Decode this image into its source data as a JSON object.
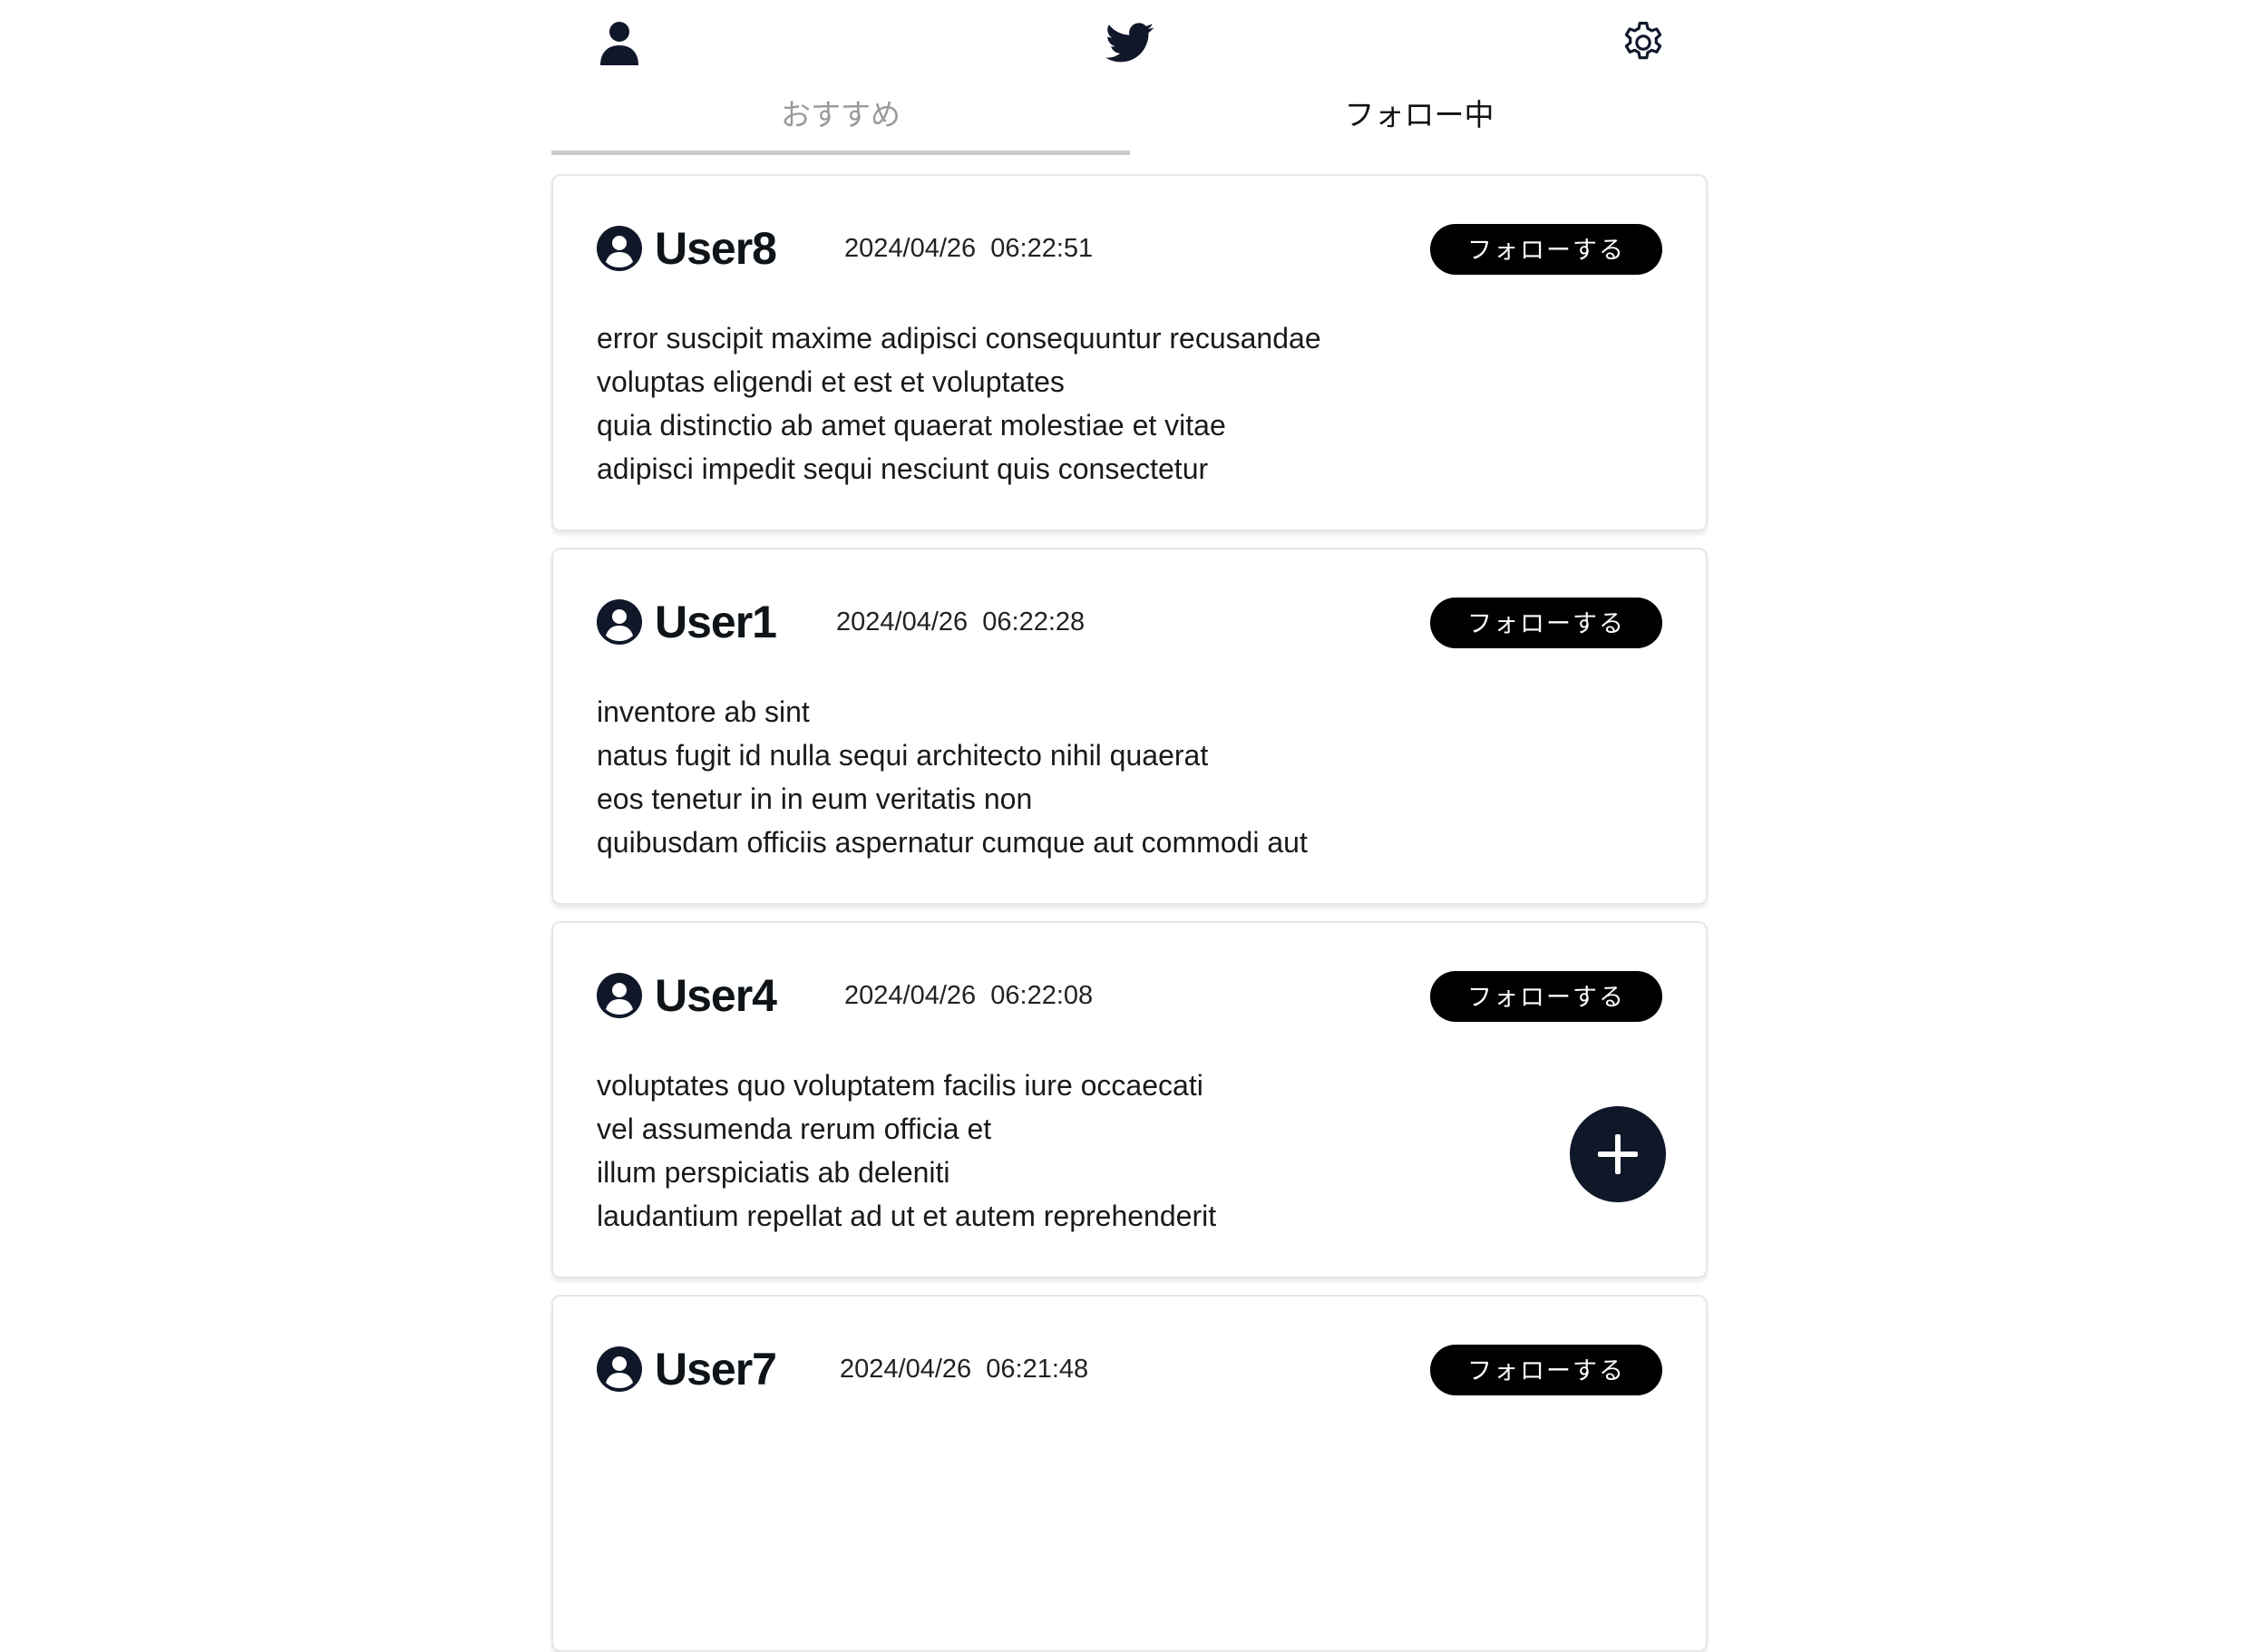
{
  "header": {
    "profile_icon": "profile-icon",
    "logo_icon": "twitter-bird-icon",
    "settings_icon": "gear-icon"
  },
  "tabs": [
    {
      "label": "おすすめ",
      "active": false
    },
    {
      "label": "フォロー中",
      "active": true
    }
  ],
  "posts": [
    {
      "username": "User8",
      "timestamp": "2024/04/26  06:22:51",
      "follow_label": "フォローする",
      "lines": [
        "error suscipit maxime adipisci consequuntur recusandae",
        "voluptas eligendi et est et voluptates",
        "quia distinctio ab amet quaerat molestiae et vitae",
        "adipisci impedit sequi nesciunt quis consectetur"
      ]
    },
    {
      "username": "User1",
      "timestamp": "2024/04/26  06:22:28",
      "follow_label": "フォローする",
      "lines": [
        "inventore ab sint",
        "natus fugit id nulla sequi architecto nihil quaerat",
        "eos tenetur in in eum veritatis non",
        "quibusdam officiis aspernatur cumque aut commodi aut"
      ]
    },
    {
      "username": "User4",
      "timestamp": "2024/04/26  06:22:08",
      "follow_label": "フォローする",
      "lines": [
        "voluptates quo voluptatem facilis iure occaecati",
        "vel assumenda rerum officia et",
        "illum perspiciatis ab deleniti",
        "laudantium repellat ad ut et autem reprehenderit"
      ]
    },
    {
      "username": "User7",
      "timestamp": "2024/04/26  06:21:48",
      "follow_label": "フォローする",
      "lines": []
    }
  ],
  "fab_icon": "plus-icon",
  "colors": {
    "primary": "#000000",
    "fab": "#0f1729",
    "tab_inactive": "#9a9a9a"
  }
}
